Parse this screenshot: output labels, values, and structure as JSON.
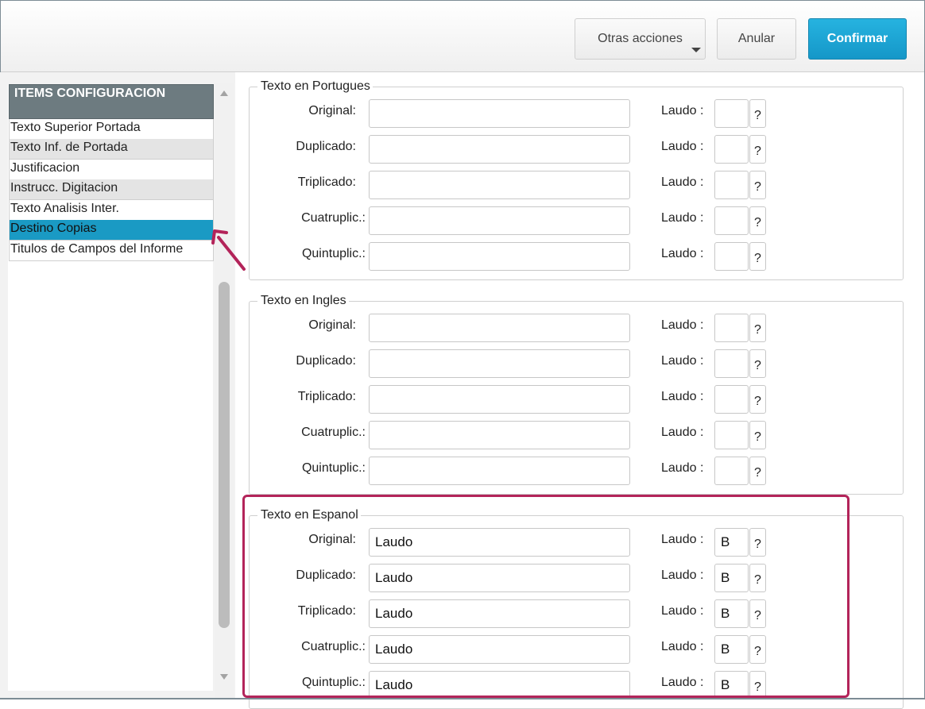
{
  "toolbar": {
    "more_actions_label": "Otras acciones",
    "cancel_label": "Anular",
    "confirm_label": "Confirmar"
  },
  "sidebar": {
    "header": "ITEMS CONFIGURACION",
    "selected_index": 5,
    "items": [
      {
        "label": "Texto Superior Portada"
      },
      {
        "label": "Texto Inf. de Portada"
      },
      {
        "label": "Justificacion"
      },
      {
        "label": "Instrucc. Digitacion"
      },
      {
        "label": "Texto Analisis Inter."
      },
      {
        "label": "Destino Copias"
      },
      {
        "label": "Titulos de Campos del Informe"
      }
    ]
  },
  "sections": [
    {
      "title": "Texto en Portugues",
      "rows": [
        {
          "label": "Original:",
          "value": "",
          "laudo_label": "Laudo :",
          "code": "",
          "help": "?"
        },
        {
          "label": "Duplicado:",
          "value": "",
          "laudo_label": "Laudo :",
          "code": "",
          "help": "?"
        },
        {
          "label": "Triplicado:",
          "value": "",
          "laudo_label": "Laudo :",
          "code": "",
          "help": "?"
        },
        {
          "label": "Cuatruplic.:",
          "value": "",
          "laudo_label": "Laudo :",
          "code": "",
          "help": "?"
        },
        {
          "label": "Quintuplic.:",
          "value": "",
          "laudo_label": "Laudo :",
          "code": "",
          "help": "?"
        }
      ]
    },
    {
      "title": "Texto en Ingles",
      "rows": [
        {
          "label": "Original:",
          "value": "",
          "laudo_label": "Laudo :",
          "code": "",
          "help": "?"
        },
        {
          "label": "Duplicado:",
          "value": "",
          "laudo_label": "Laudo :",
          "code": "",
          "help": "?"
        },
        {
          "label": "Triplicado:",
          "value": "",
          "laudo_label": "Laudo :",
          "code": "",
          "help": "?"
        },
        {
          "label": "Cuatruplic.:",
          "value": "",
          "laudo_label": "Laudo :",
          "code": "",
          "help": "?"
        },
        {
          "label": "Quintuplic.:",
          "value": "",
          "laudo_label": "Laudo :",
          "code": "",
          "help": "?"
        }
      ]
    },
    {
      "title": "Texto en Espanol",
      "rows": [
        {
          "label": "Original:",
          "value": "Laudo",
          "laudo_label": "Laudo :",
          "code": "B",
          "help": "?"
        },
        {
          "label": "Duplicado:",
          "value": "Laudo",
          "laudo_label": "Laudo :",
          "code": "B",
          "help": "?"
        },
        {
          "label": "Triplicado:",
          "value": "Laudo",
          "laudo_label": "Laudo :",
          "code": "B",
          "help": "?"
        },
        {
          "label": "Cuatruplic.:",
          "value": "Laudo",
          "laudo_label": "Laudo :",
          "code": "B",
          "help": "?"
        },
        {
          "label": "Quintuplic.:",
          "value": "Laudo",
          "laudo_label": "Laudo :",
          "code": "B",
          "help": "?"
        }
      ]
    }
  ],
  "colors": {
    "accent": "#1a9ac4",
    "confirm_button": "#1fa5d4",
    "header_bg": "#6d7b80",
    "highlight_border": "#b3245a"
  },
  "icons": {
    "dropdown": "chevron-down-icon",
    "pointer": "annotation-arrow-icon",
    "scroll_up": "scroll-up-icon",
    "scroll_down": "scroll-down-icon"
  }
}
